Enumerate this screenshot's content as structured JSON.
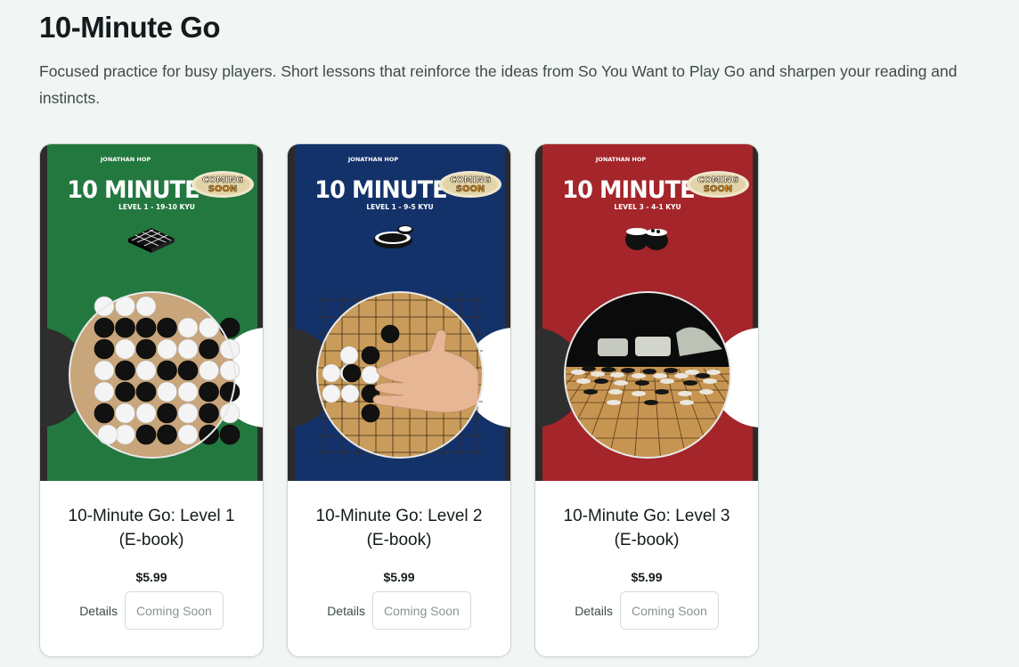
{
  "page": {
    "title": "10-Minute Go",
    "subtitle": "Focused practice for busy players. Short lessons that reinforce the ideas from So You Want to Play Go and sharpen your reading and instincts."
  },
  "products": [
    {
      "title": "10-Minute Go: Level 1 (E-book)",
      "price": "$5.99",
      "details_label": "Details",
      "button_label": "Coming Soon",
      "cover": {
        "author": "JONATHAN HOP",
        "headline": "10 MINUTE",
        "badge": [
          "COMING",
          "SOON"
        ],
        "level": "LEVEL 1 - 19-10 KYU",
        "bg_color": "#23783f",
        "photo": "stones-on-board",
        "emblem_icon": "go-board-icon"
      }
    },
    {
      "title": "10-Minute Go: Level 2 (E-book)",
      "price": "$5.99",
      "details_label": "Details",
      "button_label": "Coming Soon",
      "cover": {
        "author": "JONATHAN HOP",
        "headline": "10 MINUTE",
        "badge": [
          "COMING",
          "SOON"
        ],
        "level": "LEVEL 1 - 9-5 KYU",
        "bg_color": "#14326a",
        "photo": "hand-placing-stone",
        "emblem_icon": "go-bowls-icon"
      }
    },
    {
      "title": "10-Minute Go: Level 3 (E-book)",
      "price": "$5.99",
      "details_label": "Details",
      "button_label": "Coming Soon",
      "cover": {
        "author": "JONATHAN HOP",
        "headline": "10 MINUTE",
        "badge": [
          "COMING",
          "SOON"
        ],
        "level": "LEVEL 3 - 4-1 KYU",
        "bg_color": "#a4252a",
        "photo": "board-with-bowls",
        "emblem_icon": "go-bowls-filled-icon"
      }
    }
  ]
}
